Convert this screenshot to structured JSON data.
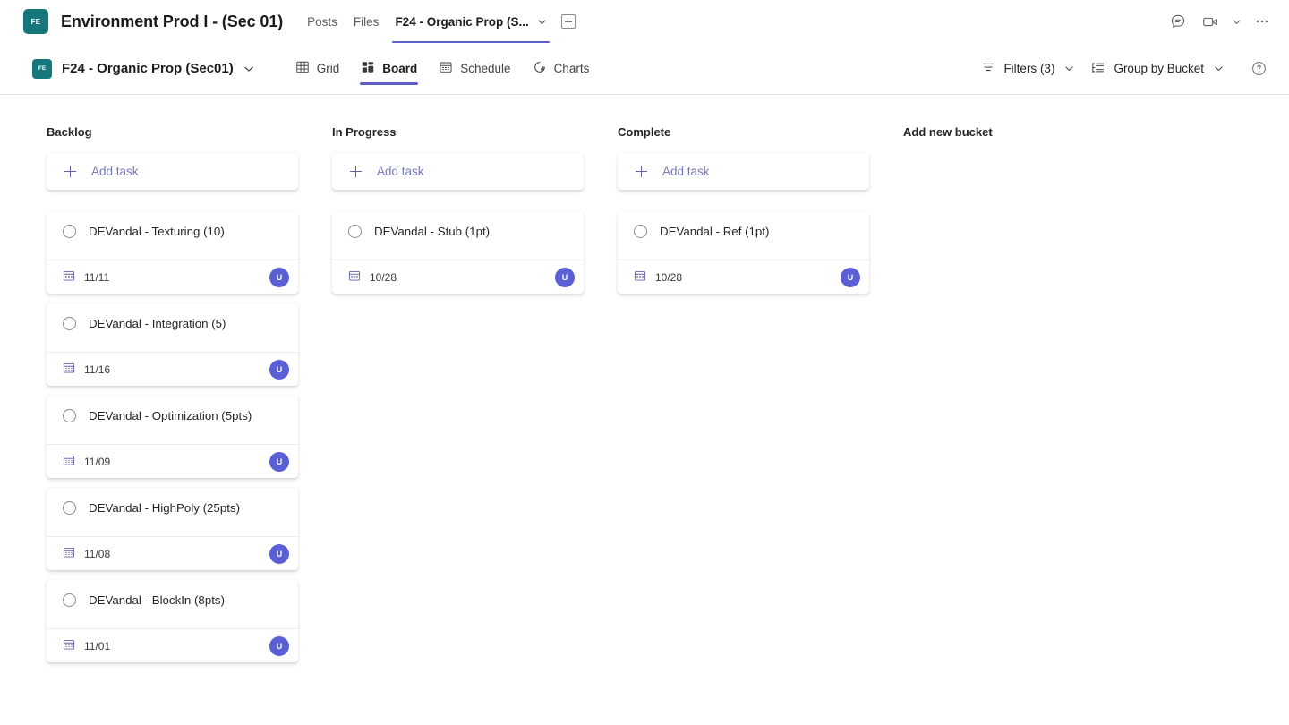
{
  "titlebar": {
    "avatar_initials": "FE",
    "team_title": "Environment Prod I - (Sec 01)",
    "tabs": [
      {
        "label": "Posts",
        "active": false,
        "has_chevron": false
      },
      {
        "label": "Files",
        "active": false,
        "has_chevron": false
      },
      {
        "label": "F24 - Organic Prop (S...",
        "active": true,
        "has_chevron": true
      }
    ],
    "add_tab_label": "Add tab",
    "right_icons": [
      {
        "name": "chat-icon"
      },
      {
        "name": "video-call-icon"
      },
      {
        "name": "chevron-down-icon"
      },
      {
        "name": "more-options-icon"
      }
    ]
  },
  "toolbar": {
    "plan_badge_initials": "FE",
    "plan_name": "F24 - Organic Prop (Sec01)",
    "views": [
      {
        "label": "Grid",
        "icon": "grid-icon",
        "active": false
      },
      {
        "label": "Board",
        "icon": "board-icon",
        "active": true
      },
      {
        "label": "Schedule",
        "icon": "calendar-icon",
        "active": false
      },
      {
        "label": "Charts",
        "icon": "chart-icon",
        "active": false
      }
    ],
    "filters_label": "Filters (3)",
    "group_by_label": "Group by Bucket",
    "help_label": "Help"
  },
  "board": {
    "add_task_label": "Add task",
    "add_new_bucket_label": "Add new bucket",
    "buckets": [
      {
        "title": "Backlog",
        "tasks": [
          {
            "title": "DEVandal - Texturing (10)",
            "due": "11/11",
            "assignee": "U"
          },
          {
            "title": "DEVandal - Integration (5)",
            "due": "11/16",
            "assignee": "U"
          },
          {
            "title": "DEVandal - Optimization (5pts)",
            "due": "11/09",
            "assignee": "U"
          },
          {
            "title": "DEVandal - HighPoly (25pts)",
            "due": "11/08",
            "assignee": "U"
          },
          {
            "title": "DEVandal - BlockIn (8pts)",
            "due": "11/01",
            "assignee": "U"
          }
        ]
      },
      {
        "title": "In Progress",
        "tasks": [
          {
            "title": "DEVandal - Stub (1pt)",
            "due": "10/28",
            "assignee": "U"
          }
        ]
      },
      {
        "title": "Complete",
        "tasks": [
          {
            "title": "DEVandal - Ref (1pt)",
            "due": "10/28",
            "assignee": "U"
          }
        ]
      }
    ]
  },
  "colors": {
    "accent_purple": "#5b5fc7",
    "team_teal": "#16787d",
    "avatar_blue": "#5b5fd6",
    "link_purple": "#7679b8"
  }
}
